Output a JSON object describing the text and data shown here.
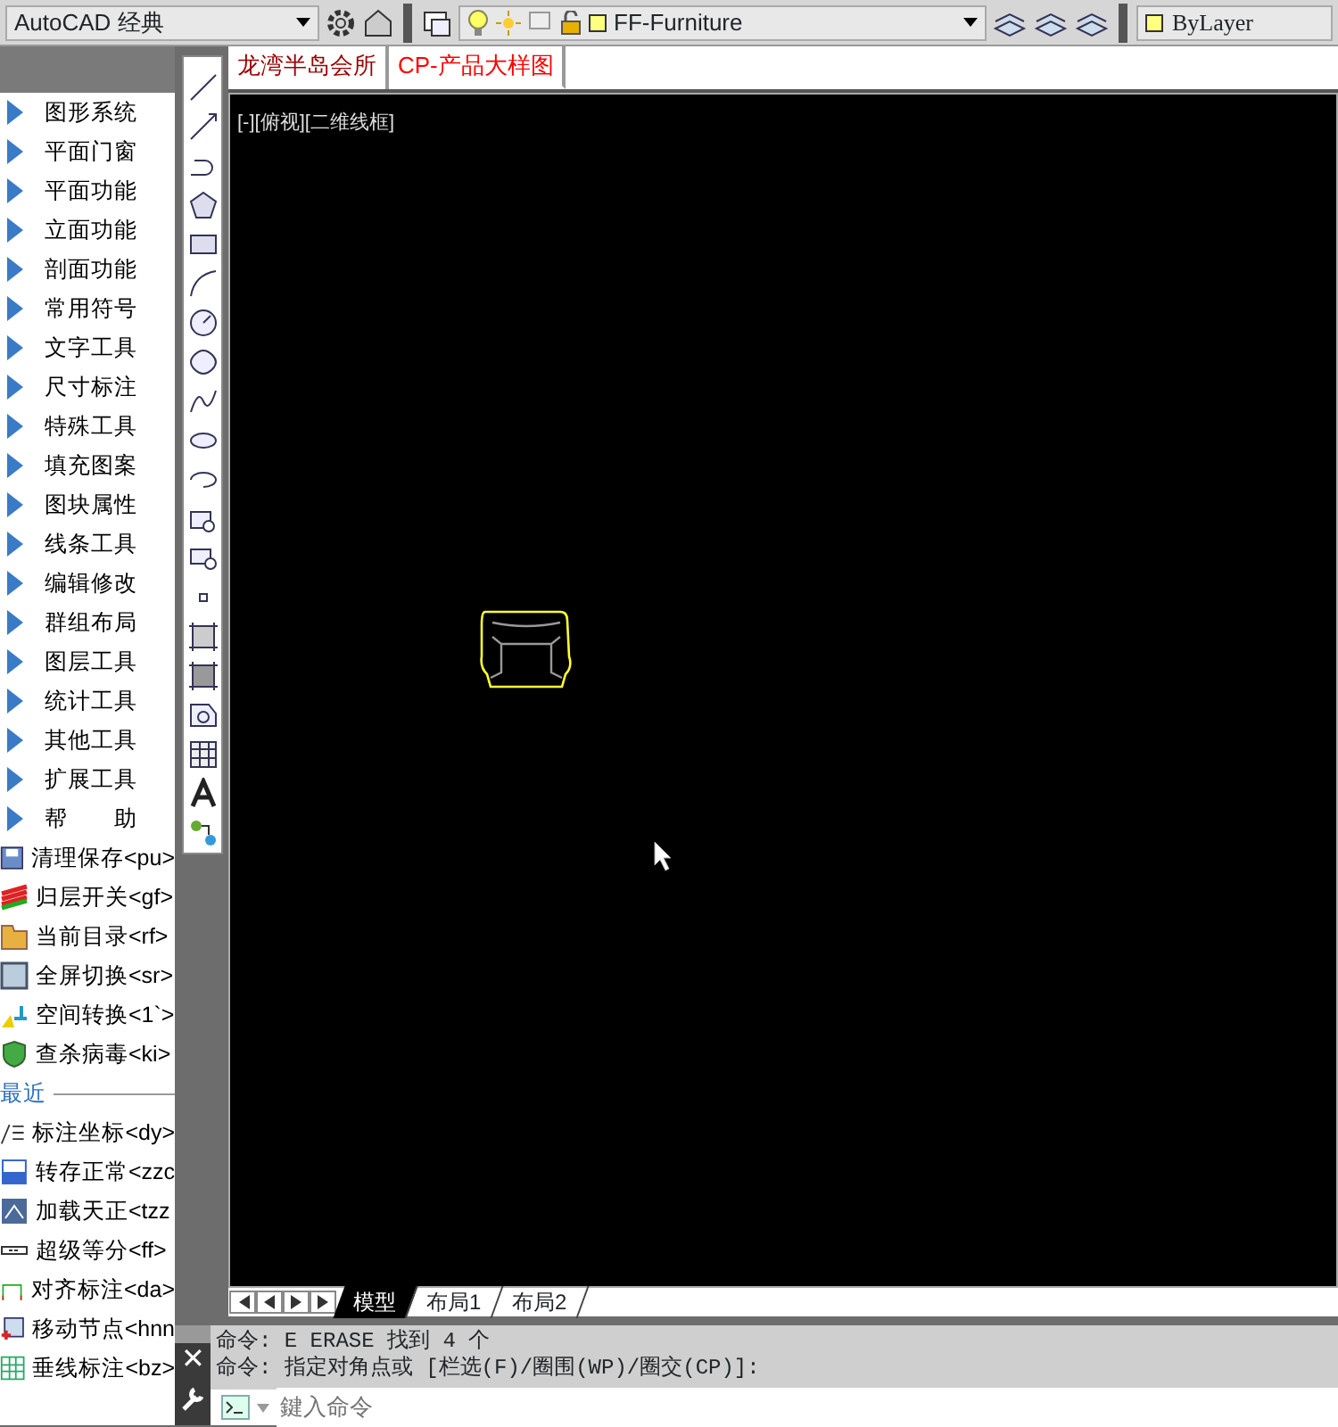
{
  "toolbar": {
    "workspace": "AutoCAD 经典",
    "layer": "FF-Furniture",
    "color_control": "ByLayer"
  },
  "file_tabs": [
    {
      "label": "龙湾半岛会所",
      "selected": false
    },
    {
      "label": "CP-产品大样图",
      "selected": true
    }
  ],
  "side_menu": [
    {
      "kind": "menu",
      "label": "图形系统"
    },
    {
      "kind": "menu",
      "label": "平面门窗"
    },
    {
      "kind": "menu",
      "label": "平面功能"
    },
    {
      "kind": "menu",
      "label": "立面功能"
    },
    {
      "kind": "menu",
      "label": "剖面功能"
    },
    {
      "kind": "menu",
      "label": "常用符号"
    },
    {
      "kind": "menu",
      "label": "文字工具"
    },
    {
      "kind": "menu",
      "label": "尺寸标注"
    },
    {
      "kind": "menu",
      "label": "特殊工具"
    },
    {
      "kind": "menu",
      "label": "填充图案"
    },
    {
      "kind": "menu",
      "label": "图块属性"
    },
    {
      "kind": "menu",
      "label": "线条工具"
    },
    {
      "kind": "menu",
      "label": "编辑修改"
    },
    {
      "kind": "menu",
      "label": "群组布局"
    },
    {
      "kind": "menu",
      "label": "图层工具"
    },
    {
      "kind": "menu",
      "label": "统计工具"
    },
    {
      "kind": "menu",
      "label": "其他工具"
    },
    {
      "kind": "menu",
      "label": "扩展工具"
    },
    {
      "kind": "menu",
      "label": "帮　　助"
    },
    {
      "kind": "tool",
      "label": "清理保存<pu>"
    },
    {
      "kind": "tool",
      "label": "归层开关<gf>"
    },
    {
      "kind": "tool",
      "label": "当前目录<rf>"
    },
    {
      "kind": "tool",
      "label": "全屏切换<sr>"
    },
    {
      "kind": "tool",
      "label": "空间转换<1`>"
    },
    {
      "kind": "tool",
      "label": "查杀病毒<ki>"
    },
    {
      "kind": "header",
      "label": "最近"
    },
    {
      "kind": "tool",
      "label": "标注坐标<dy>"
    },
    {
      "kind": "tool",
      "label": "转存正常<zzc"
    },
    {
      "kind": "tool",
      "label": "加载天正<tzz"
    },
    {
      "kind": "tool",
      "label": "超级等分<ff>"
    },
    {
      "kind": "tool",
      "label": "对齐标注<da>"
    },
    {
      "kind": "tool",
      "label": "移动节点<hnn"
    },
    {
      "kind": "tool",
      "label": "垂线标注<bz>"
    }
  ],
  "viewport": {
    "label": "[-][俯视][二维线框]"
  },
  "layout_tabs": [
    {
      "label": "模型",
      "selected": true
    },
    {
      "label": "布局1",
      "selected": false
    },
    {
      "label": "布局2",
      "selected": false
    }
  ],
  "command_history": [
    "命令: E ERASE 找到 4 个",
    "命令: 指定对角点或 [栏选(F)/圈围(WP)/圈交(CP)]:"
  ],
  "command_input": {
    "placeholder": "鍵入命令"
  },
  "command_close": "✕"
}
